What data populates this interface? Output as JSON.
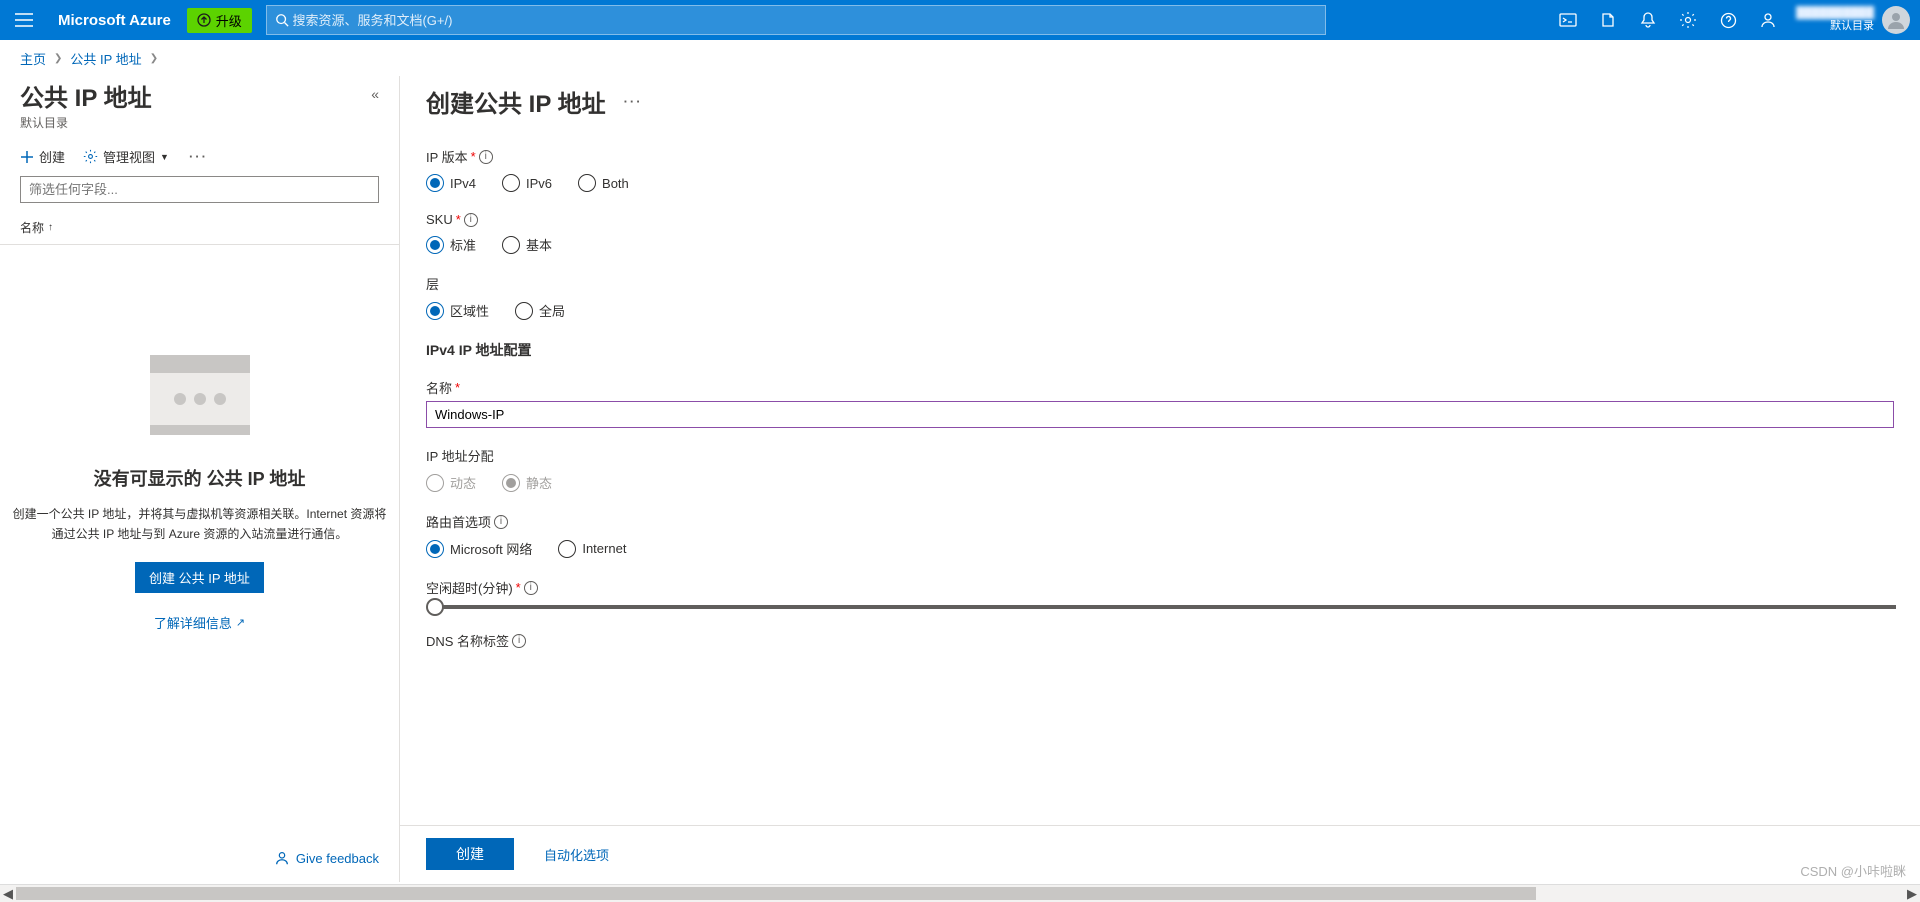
{
  "header": {
    "brand": "Microsoft Azure",
    "upgrade": "升级",
    "search_placeholder": "搜索资源、服务和文档(G+/)",
    "directory": "默认目录"
  },
  "breadcrumbs": {
    "home": "主页",
    "level1": "公共 IP 地址"
  },
  "left": {
    "title": "公共 IP 地址",
    "subtitle": "默认目录",
    "toolbar": {
      "create": "创建",
      "manage_view": "管理视图"
    },
    "filter_placeholder": "筛选任何字段...",
    "col_name": "名称",
    "empty_title": "没有可显示的 公共 IP 地址",
    "empty_desc": "创建一个公共 IP 地址，并将其与虚拟机等资源相关联。Internet 资源将通过公共 IP 地址与到 Azure 资源的入站流量进行通信。",
    "create_btn": "创建 公共 IP 地址",
    "learn_more": "了解详细信息",
    "feedback": "Give feedback"
  },
  "form": {
    "title": "创建公共 IP 地址",
    "ip_version_label": "IP 版本",
    "ip_version": {
      "ipv4": "IPv4",
      "ipv6": "IPv6",
      "both": "Both"
    },
    "sku_label": "SKU",
    "sku": {
      "standard": "标准",
      "basic": "基本"
    },
    "tier_label": "层",
    "tier": {
      "regional": "区域性",
      "global": "全局"
    },
    "ipv4_section": "IPv4 IP 地址配置",
    "name_label": "名称",
    "name_value": "Windows-IP",
    "assignment_label": "IP 地址分配",
    "assignment": {
      "dynamic": "动态",
      "static": "静态"
    },
    "routing_label": "路由首选项",
    "routing": {
      "ms": "Microsoft 网络",
      "internet": "Internet"
    },
    "timeout_label": "空闲超时(分钟)",
    "dns_label": "DNS 名称标签",
    "footer": {
      "create": "创建",
      "automation": "自动化选项"
    }
  },
  "watermark": "CSDN @小咔啦眯"
}
